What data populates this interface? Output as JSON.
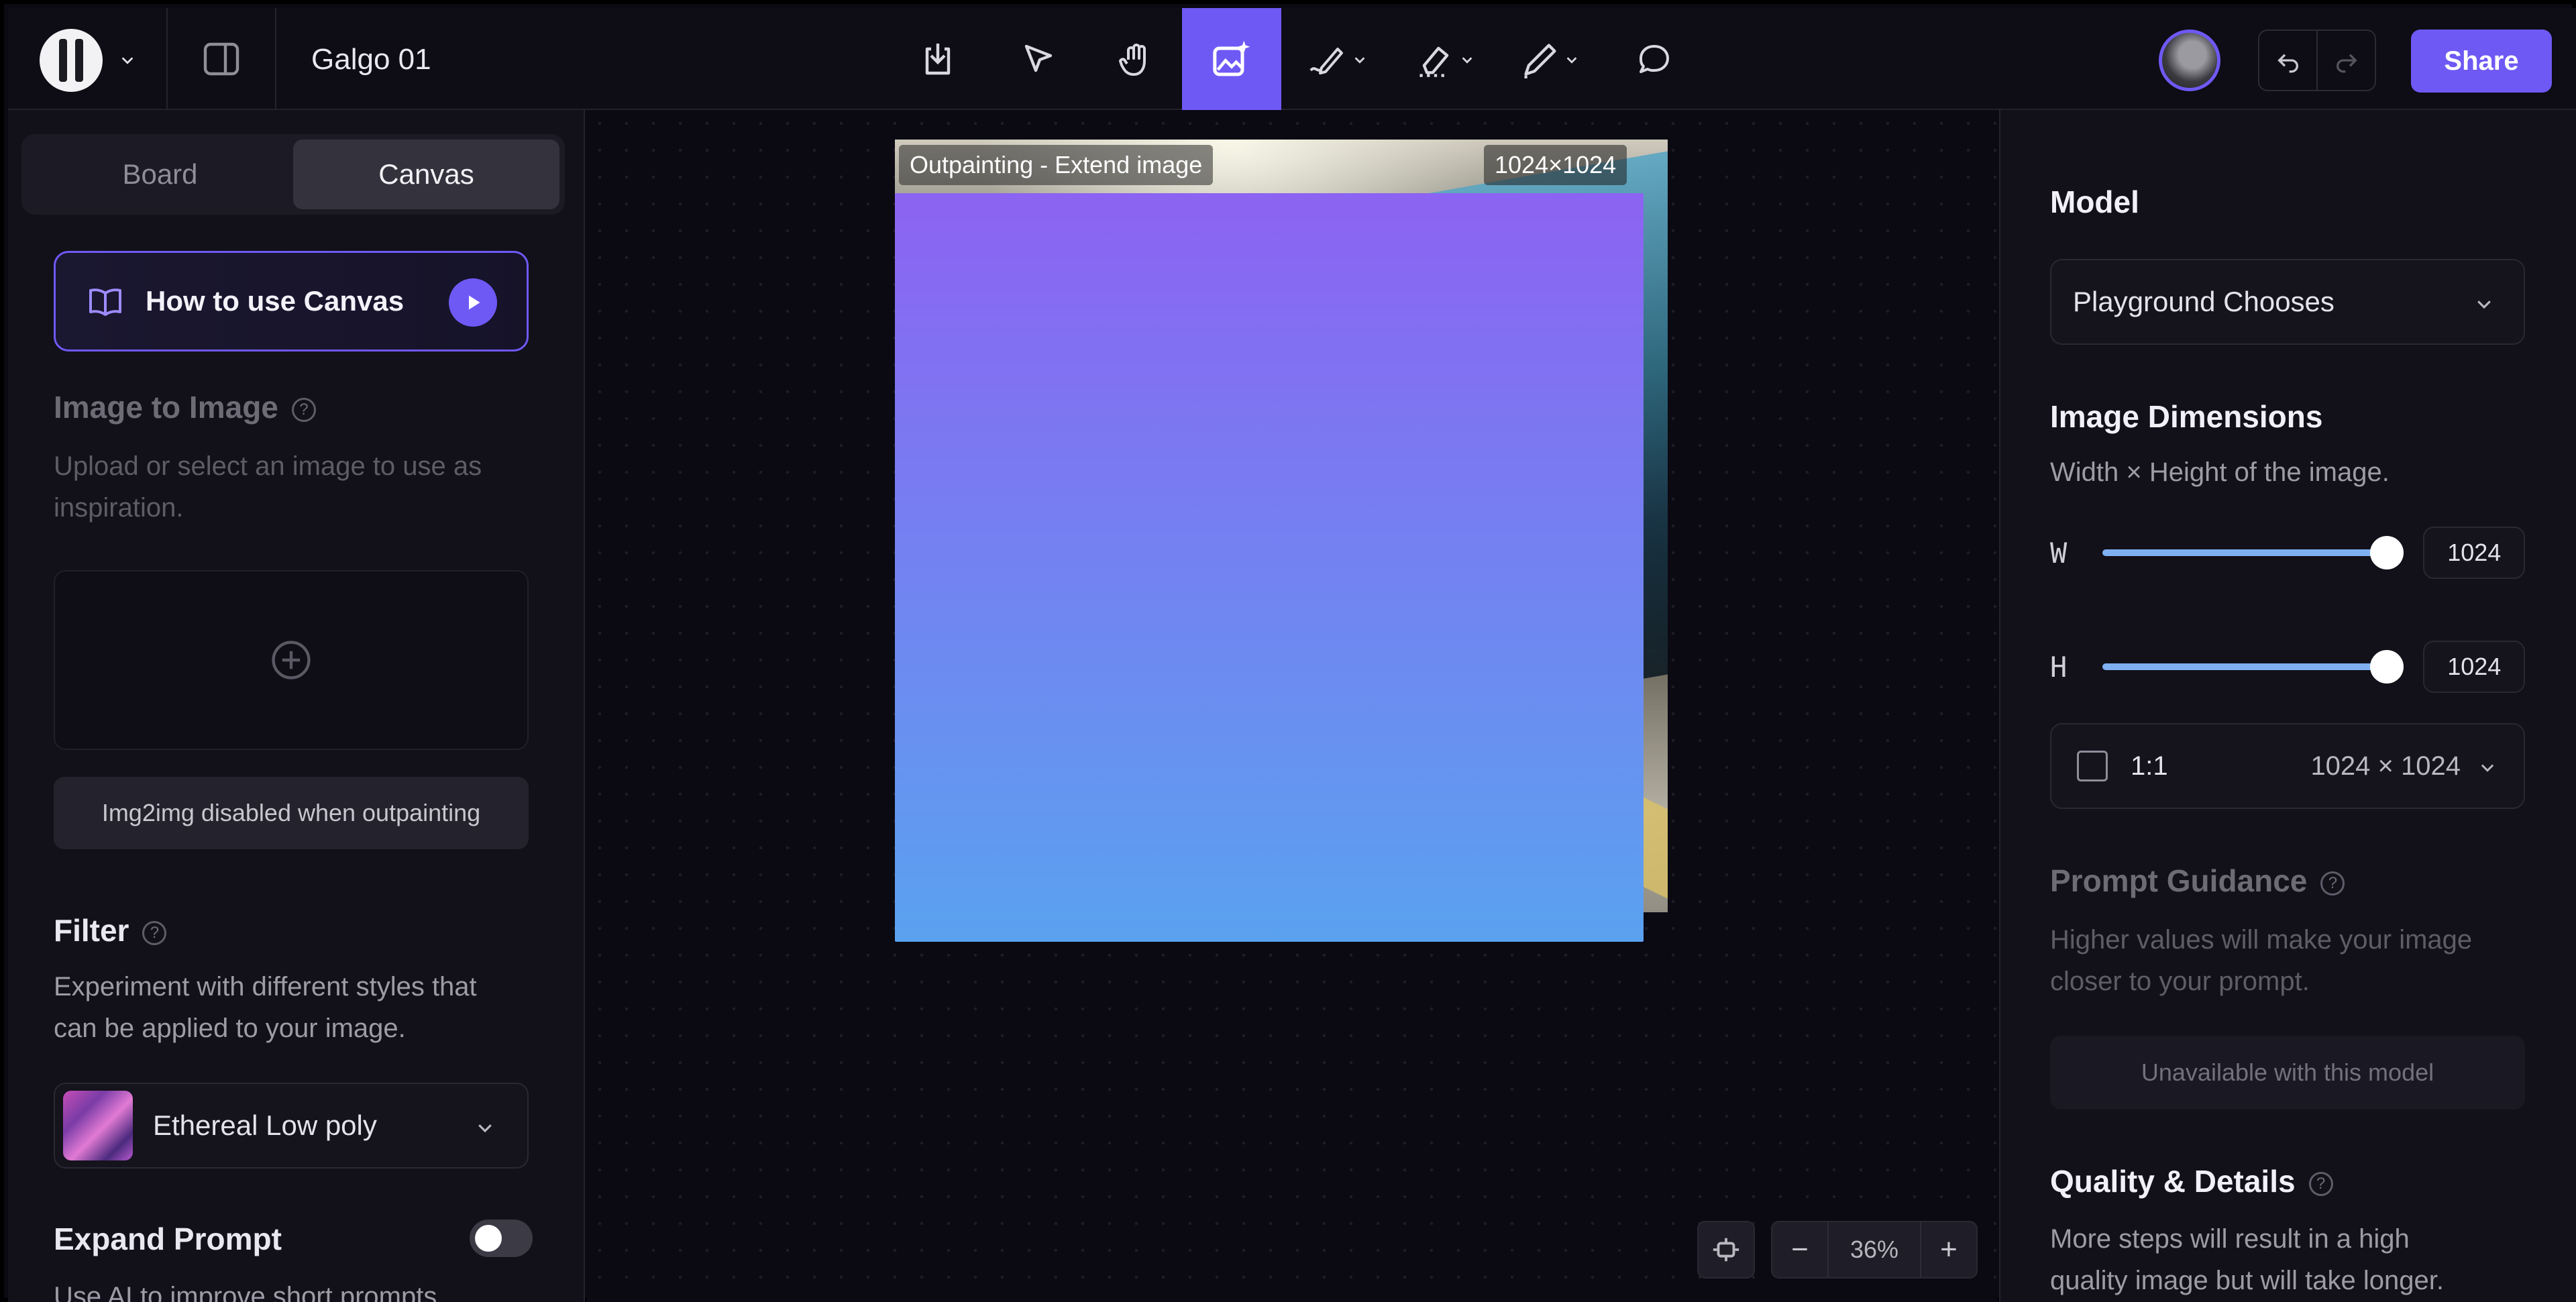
{
  "topbar": {
    "document_title": "Galgo 01",
    "tools": [
      "import-tool",
      "select-tool",
      "hand-tool",
      "outpaint-tool",
      "draw-tool",
      "erase-tool",
      "pencil-tool",
      "comment-tool"
    ],
    "share_label": "Share"
  },
  "left": {
    "tabs": [
      "Board",
      "Canvas"
    ],
    "active_tab": "Canvas",
    "howto_label": "How to use Canvas",
    "img2img": {
      "title": "Image to Image",
      "desc_line1": "Upload or select an image to use as",
      "desc_line2": "inspiration.",
      "disabled_note": "Img2img disabled when outpainting"
    },
    "filter": {
      "title": "Filter",
      "desc_line1": "Experiment with different styles that",
      "desc_line2": "can be applied to your image.",
      "selected": "Ethereal Low poly"
    },
    "expand_prompt": {
      "title": "Expand Prompt",
      "enabled": false,
      "desc": "Use AI to improve short prompts"
    }
  },
  "canvas": {
    "frame_label": "Outpainting - Extend image",
    "frame_size": "1024×1024",
    "zoom": "36%",
    "zoom_out": "−",
    "zoom_in": "+"
  },
  "right": {
    "model": {
      "title": "Model",
      "selected": "Playground Chooses"
    },
    "dimensions": {
      "title": "Image Dimensions",
      "desc": "Width × Height of the image.",
      "w_label": "W",
      "h_label": "H",
      "w_value": "1024",
      "h_value": "1024",
      "w_fraction": 1.0,
      "h_fraction": 1.0,
      "ratio_label": "1:1",
      "ratio_dims": "1024 × 1024"
    },
    "prompt_guidance": {
      "title": "Prompt Guidance",
      "desc_line1": "Higher values will make your image",
      "desc_line2": "closer to your prompt.",
      "unavailable": "Unavailable with this model"
    },
    "quality": {
      "title": "Quality & Details",
      "desc_line1": "More steps will result in a high",
      "desc_line2": "quality image but will take longer."
    }
  },
  "colors": {
    "accent": "#6e59f5",
    "background": "#0b0912",
    "panel": "#121019"
  }
}
